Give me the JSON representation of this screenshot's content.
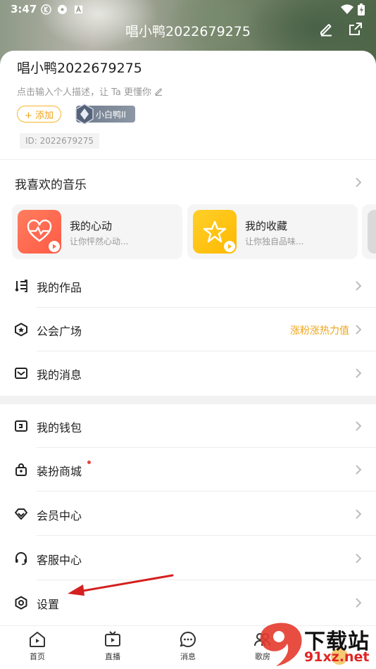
{
  "status_bar": {
    "time": "3:47"
  },
  "header": {
    "title": "唱小鸭2022679275"
  },
  "profile": {
    "name": "唱小鸭2022679275",
    "description": "点击输入个人描述，让 Ta 更懂你",
    "add_label": "+ 添加",
    "level_label": "小白鸭II",
    "id_label": "ID: 2022679275"
  },
  "music_section": {
    "title": "我喜欢的音乐",
    "cards": [
      {
        "title": "我的心动",
        "subtitle": "让你怦然心动...",
        "color": "#ff6a4f"
      },
      {
        "title": "我的收藏",
        "subtitle": "让你独自品味...",
        "color": "#ffc21a"
      }
    ]
  },
  "menu_group1": [
    {
      "label": "我的作品",
      "icon": "music-note-list-icon",
      "extra": ""
    },
    {
      "label": "公会广场",
      "icon": "guild-hexagon-icon",
      "extra": "涨粉涨热力值"
    },
    {
      "label": "我的消息",
      "icon": "mail-icon",
      "extra": ""
    }
  ],
  "menu_group2": [
    {
      "label": "我的钱包",
      "icon": "wallet-icon"
    },
    {
      "label": "装扮商城",
      "icon": "shop-bag-icon",
      "badge": "red-dot"
    },
    {
      "label": "会员中心",
      "icon": "diamond-icon"
    },
    {
      "label": "客服中心",
      "icon": "headset-icon"
    },
    {
      "label": "设置",
      "icon": "gear-icon"
    }
  ],
  "tabbar": {
    "items": [
      {
        "label": "首页",
        "icon": "home-play-icon"
      },
      {
        "label": "直播",
        "icon": "tv-icon"
      },
      {
        "label": "消息",
        "icon": "chat-icon"
      },
      {
        "label": "歌房",
        "icon": "users-icon"
      }
    ]
  },
  "watermark": {
    "line1": "下载站",
    "line2": "91xz.net"
  },
  "colors": {
    "accent": "#f0a417",
    "red": "#e02424"
  }
}
